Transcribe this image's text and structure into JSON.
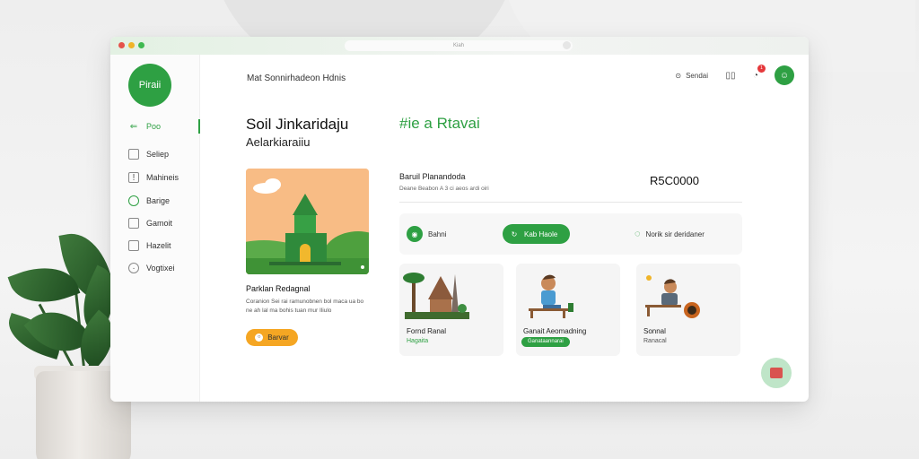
{
  "browser": {
    "url": "Kiah"
  },
  "sidebar": {
    "logo_text": "Piraii",
    "items": [
      {
        "label": "Poo",
        "icon": "back-arrow-icon",
        "active": true
      },
      {
        "label": "Seliep",
        "icon": "box-icon",
        "active": false
      },
      {
        "label": "Mahineis",
        "icon": "file-icon",
        "active": false
      },
      {
        "label": "Barige",
        "icon": "leaf-icon",
        "active": false
      },
      {
        "label": "Gamoit",
        "icon": "square-icon",
        "active": false
      },
      {
        "label": "Hazelit",
        "icon": "book-icon",
        "active": false
      },
      {
        "label": "Vogtixei",
        "icon": "gear-icon",
        "active": false
      }
    ]
  },
  "header": {
    "title": "Mat Sonnirhadeon Hdnis",
    "search_label": "Sendai",
    "notification_count": "1"
  },
  "hero": {
    "title": "Soil Jinkaridaju",
    "subtitle": "Aelarkiaraiiu",
    "green_heading": "#ie a Rtavai"
  },
  "feature": {
    "name": "Parklan Redagnal",
    "description": "Coranion Sei rai ramunobnen bol maca ua bo ne ah lal ma bohis tuan mur Iliulo",
    "button_label": "Barvar"
  },
  "info": {
    "label": "Baruil Planandoda",
    "sublabel": "Deane Beabon A 3 ci aeos ardi oiri",
    "price": "R5C0000"
  },
  "actions": [
    {
      "label": "Bahni",
      "icon": "circle-icon",
      "primary": false
    },
    {
      "label": "Kab Haole",
      "icon": "refresh-icon",
      "primary": true
    },
    {
      "label": "Norik sir deridaner",
      "icon": "chat-icon",
      "primary": false
    }
  ],
  "cards": [
    {
      "title": "Fornd Ranal",
      "sub": "Hagaita",
      "style": "green"
    },
    {
      "title": "Ganait Aeomadning",
      "sub": "Ganataannarai",
      "style": "tag"
    },
    {
      "title": "Sonnal",
      "sub": "Ranacal",
      "style": "gray"
    }
  ],
  "colors": {
    "accent": "#2ea043",
    "orange": "#f5a623",
    "badge": "#e5383b"
  }
}
